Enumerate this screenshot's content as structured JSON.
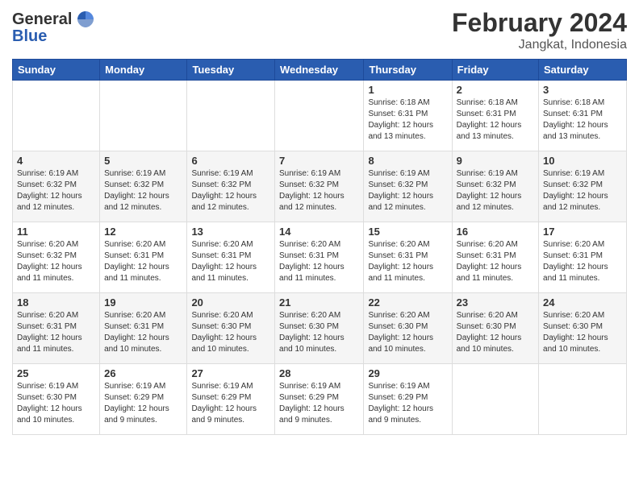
{
  "header": {
    "logo_line1": "General",
    "logo_line2": "Blue",
    "month_year": "February 2024",
    "location": "Jangkat, Indonesia"
  },
  "days_of_week": [
    "Sunday",
    "Monday",
    "Tuesday",
    "Wednesday",
    "Thursday",
    "Friday",
    "Saturday"
  ],
  "weeks": [
    [
      {
        "day": "",
        "info": ""
      },
      {
        "day": "",
        "info": ""
      },
      {
        "day": "",
        "info": ""
      },
      {
        "day": "",
        "info": ""
      },
      {
        "day": "1",
        "info": "Sunrise: 6:18 AM\nSunset: 6:31 PM\nDaylight: 12 hours\nand 13 minutes."
      },
      {
        "day": "2",
        "info": "Sunrise: 6:18 AM\nSunset: 6:31 PM\nDaylight: 12 hours\nand 13 minutes."
      },
      {
        "day": "3",
        "info": "Sunrise: 6:18 AM\nSunset: 6:31 PM\nDaylight: 12 hours\nand 13 minutes."
      }
    ],
    [
      {
        "day": "4",
        "info": "Sunrise: 6:19 AM\nSunset: 6:32 PM\nDaylight: 12 hours\nand 12 minutes."
      },
      {
        "day": "5",
        "info": "Sunrise: 6:19 AM\nSunset: 6:32 PM\nDaylight: 12 hours\nand 12 minutes."
      },
      {
        "day": "6",
        "info": "Sunrise: 6:19 AM\nSunset: 6:32 PM\nDaylight: 12 hours\nand 12 minutes."
      },
      {
        "day": "7",
        "info": "Sunrise: 6:19 AM\nSunset: 6:32 PM\nDaylight: 12 hours\nand 12 minutes."
      },
      {
        "day": "8",
        "info": "Sunrise: 6:19 AM\nSunset: 6:32 PM\nDaylight: 12 hours\nand 12 minutes."
      },
      {
        "day": "9",
        "info": "Sunrise: 6:19 AM\nSunset: 6:32 PM\nDaylight: 12 hours\nand 12 minutes."
      },
      {
        "day": "10",
        "info": "Sunrise: 6:19 AM\nSunset: 6:32 PM\nDaylight: 12 hours\nand 12 minutes."
      }
    ],
    [
      {
        "day": "11",
        "info": "Sunrise: 6:20 AM\nSunset: 6:32 PM\nDaylight: 12 hours\nand 11 minutes."
      },
      {
        "day": "12",
        "info": "Sunrise: 6:20 AM\nSunset: 6:31 PM\nDaylight: 12 hours\nand 11 minutes."
      },
      {
        "day": "13",
        "info": "Sunrise: 6:20 AM\nSunset: 6:31 PM\nDaylight: 12 hours\nand 11 minutes."
      },
      {
        "day": "14",
        "info": "Sunrise: 6:20 AM\nSunset: 6:31 PM\nDaylight: 12 hours\nand 11 minutes."
      },
      {
        "day": "15",
        "info": "Sunrise: 6:20 AM\nSunset: 6:31 PM\nDaylight: 12 hours\nand 11 minutes."
      },
      {
        "day": "16",
        "info": "Sunrise: 6:20 AM\nSunset: 6:31 PM\nDaylight: 12 hours\nand 11 minutes."
      },
      {
        "day": "17",
        "info": "Sunrise: 6:20 AM\nSunset: 6:31 PM\nDaylight: 12 hours\nand 11 minutes."
      }
    ],
    [
      {
        "day": "18",
        "info": "Sunrise: 6:20 AM\nSunset: 6:31 PM\nDaylight: 12 hours\nand 11 minutes."
      },
      {
        "day": "19",
        "info": "Sunrise: 6:20 AM\nSunset: 6:31 PM\nDaylight: 12 hours\nand 10 minutes."
      },
      {
        "day": "20",
        "info": "Sunrise: 6:20 AM\nSunset: 6:30 PM\nDaylight: 12 hours\nand 10 minutes."
      },
      {
        "day": "21",
        "info": "Sunrise: 6:20 AM\nSunset: 6:30 PM\nDaylight: 12 hours\nand 10 minutes."
      },
      {
        "day": "22",
        "info": "Sunrise: 6:20 AM\nSunset: 6:30 PM\nDaylight: 12 hours\nand 10 minutes."
      },
      {
        "day": "23",
        "info": "Sunrise: 6:20 AM\nSunset: 6:30 PM\nDaylight: 12 hours\nand 10 minutes."
      },
      {
        "day": "24",
        "info": "Sunrise: 6:20 AM\nSunset: 6:30 PM\nDaylight: 12 hours\nand 10 minutes."
      }
    ],
    [
      {
        "day": "25",
        "info": "Sunrise: 6:19 AM\nSunset: 6:30 PM\nDaylight: 12 hours\nand 10 minutes."
      },
      {
        "day": "26",
        "info": "Sunrise: 6:19 AM\nSunset: 6:29 PM\nDaylight: 12 hours\nand 9 minutes."
      },
      {
        "day": "27",
        "info": "Sunrise: 6:19 AM\nSunset: 6:29 PM\nDaylight: 12 hours\nand 9 minutes."
      },
      {
        "day": "28",
        "info": "Sunrise: 6:19 AM\nSunset: 6:29 PM\nDaylight: 12 hours\nand 9 minutes."
      },
      {
        "day": "29",
        "info": "Sunrise: 6:19 AM\nSunset: 6:29 PM\nDaylight: 12 hours\nand 9 minutes."
      },
      {
        "day": "",
        "info": ""
      },
      {
        "day": "",
        "info": ""
      }
    ]
  ]
}
